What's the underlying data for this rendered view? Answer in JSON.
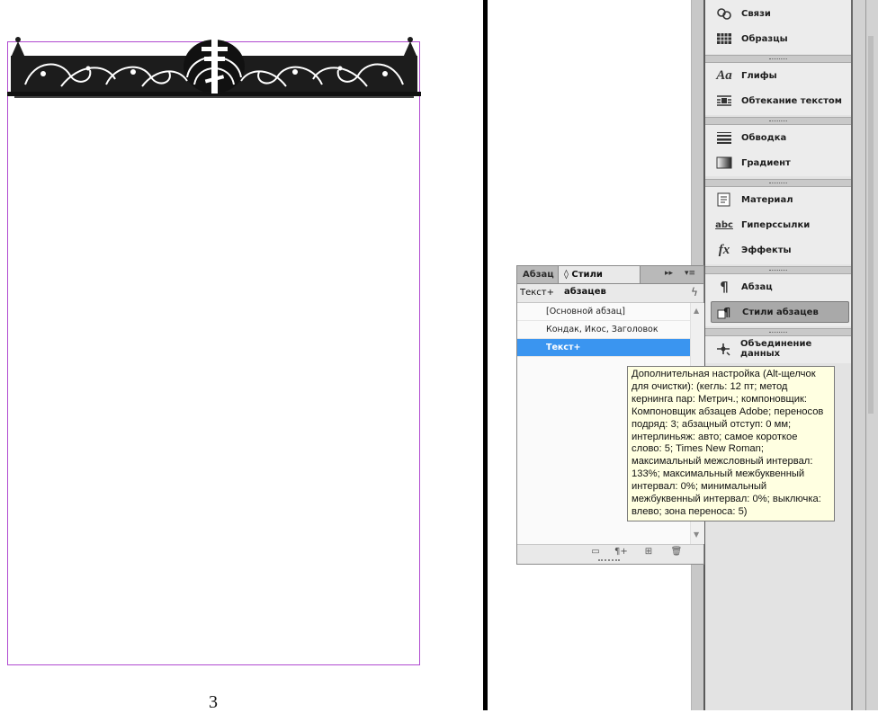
{
  "document": {
    "page_number": "3"
  },
  "dock": {
    "items": [
      {
        "id": "links",
        "label": "Связи",
        "icon": "links-icon"
      },
      {
        "id": "swatches",
        "label": "Образцы",
        "icon": "swatches-icon"
      },
      {
        "id": "glyphs",
        "label": "Глифы",
        "icon": "glyphs-icon"
      },
      {
        "id": "text-wrap",
        "label": "Обтекание текстом",
        "icon": "text-wrap-icon"
      },
      {
        "id": "stroke",
        "label": "Обводка",
        "icon": "stroke-icon"
      },
      {
        "id": "gradient",
        "label": "Градиент",
        "icon": "gradient-icon"
      },
      {
        "id": "story",
        "label": "Материал",
        "icon": "story-icon"
      },
      {
        "id": "hyperlinks",
        "label": "Гиперссылки",
        "icon": "hyperlinks-icon"
      },
      {
        "id": "effects",
        "label": "Эффекты",
        "icon": "effects-icon"
      },
      {
        "id": "paragraph",
        "label": "Абзац",
        "icon": "paragraph-icon"
      },
      {
        "id": "paragraph-styles",
        "label": "Стили абзацев",
        "icon": "paragraph-styles-icon",
        "active": true
      },
      {
        "id": "data-merge",
        "label": "Объединение данных",
        "icon": "data-merge-icon"
      }
    ]
  },
  "panel": {
    "tab_paragraph": "Абзац",
    "tab_paragraph_styles": "◊ Стили абзацев",
    "collapse_glyph": "▸▸",
    "menu_glyph": "▾≡",
    "current_style": "Текст+",
    "styles": [
      {
        "label": "[Основной абзац]",
        "selected": false
      },
      {
        "label": "Кондак, Икос, Заголовок",
        "selected": false
      },
      {
        "label": "Текст+",
        "selected": true
      }
    ]
  },
  "tooltip": {
    "text": "Дополнительная настройка (Alt-щелчок для очистки):  (кегль: 12 пт; метод кернинга пар: Метрич.; компоновщик:  Компоновщик абзацев Adobe; переносов подряд: 3; абзацный отступ: 0 мм; интерлиньяж: авто; самое короткое слово: 5; Times New Roman; максимальный межсловный интервал: 133%; максимальный межбуквенный интервал: 0%; минимальный межбуквенный интервал: 0%; выключка: влево; зона переноса: 5)"
  },
  "colors": {
    "selection": "#3a95f0",
    "page_frame": "#b04ad0",
    "tooltip_bg": "#ffffe1"
  }
}
